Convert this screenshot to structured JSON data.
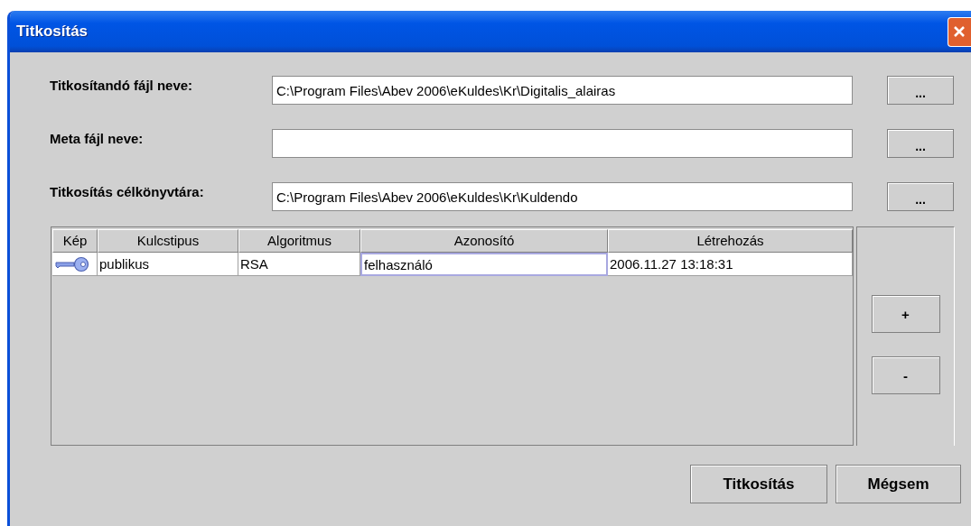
{
  "window": {
    "title": "Titkosítás"
  },
  "fields": [
    {
      "label": "Titkosítandó fájl neve:",
      "value": "C:\\Program Files\\Abev 2006\\eKuldes\\Kr\\Digitalis_alairas",
      "button": "..."
    },
    {
      "label": "Meta fájl neve:",
      "button": "..."
    },
    {
      "label": "Titkosítás célkönyvtára:",
      "value": "C:\\Program Files\\Abev 2006\\eKuldes\\Kr\\Kuldendo",
      "button": "..."
    }
  ],
  "table": {
    "columns": [
      "Kép",
      "Kulcstipus",
      "Algoritmus",
      "Azonosító",
      "Létrehozás"
    ],
    "rows": [
      {
        "cells": [
          {
            "kind": "icon",
            "focused": false
          },
          {
            "kind": "text",
            "text": "publikus",
            "focused": false
          },
          {
            "kind": "text",
            "text": "RSA",
            "focused": false
          },
          {
            "kind": "text",
            "text": "felhasználó",
            "focused": true
          },
          {
            "kind": "text",
            "text": "2006.11.27 13:18:31",
            "focused": false
          }
        ]
      }
    ]
  },
  "side_buttons": [
    "+",
    "-"
  ],
  "buttons": [
    "Titkosítás",
    "Mégsem"
  ]
}
